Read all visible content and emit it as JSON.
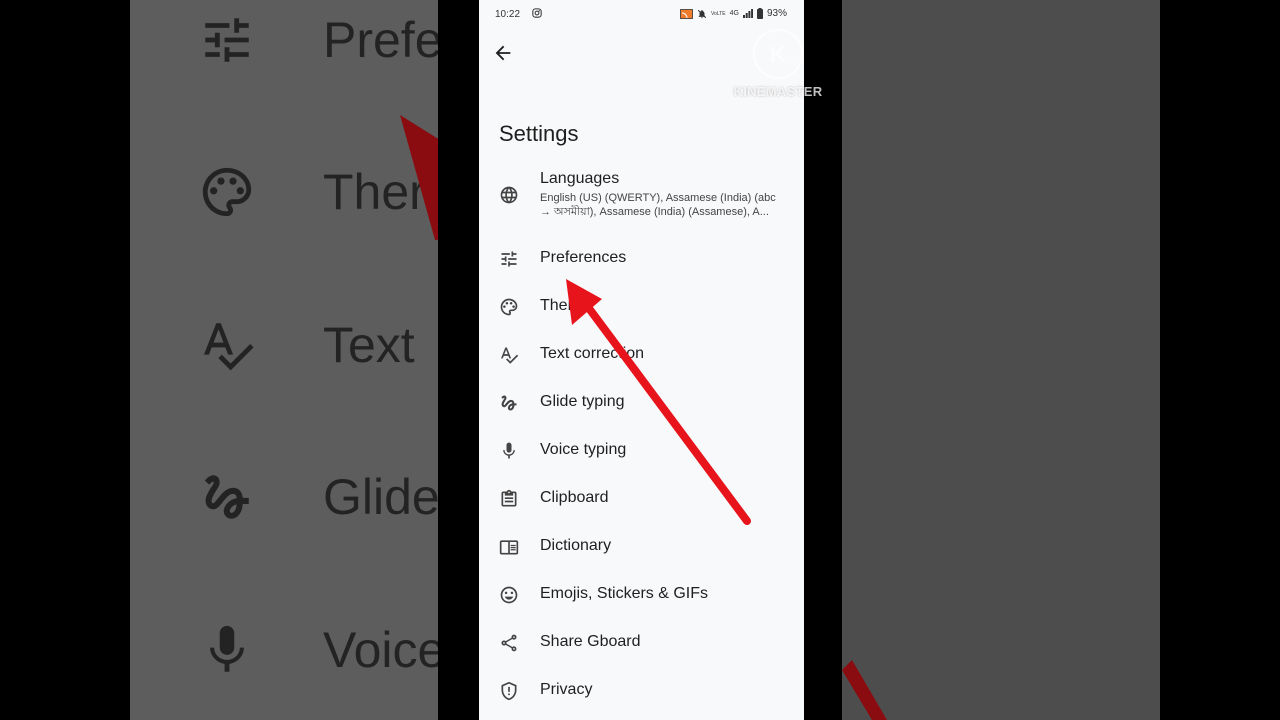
{
  "status_bar": {
    "time": "10:22",
    "battery": "93%",
    "network": "4G",
    "signal_text": "VoLTE"
  },
  "header": {
    "title": "Settings"
  },
  "settings": [
    {
      "label": "Languages",
      "subtitle_line1": "English (US) (QWERTY), Assamese (India) (abc",
      "subtitle_line2": "→ অসমীয়া), Assamese (India) (Assamese), A...",
      "icon": "globe-icon"
    },
    {
      "label": "Preferences",
      "icon": "tune-icon"
    },
    {
      "label": "Theme",
      "icon": "palette-icon"
    },
    {
      "label": "Text correction",
      "icon": "spellcheck-icon"
    },
    {
      "label": "Glide typing",
      "icon": "gesture-icon"
    },
    {
      "label": "Voice typing",
      "icon": "mic-icon"
    },
    {
      "label": "Clipboard",
      "icon": "clipboard-icon"
    },
    {
      "label": "Dictionary",
      "icon": "dictionary-icon"
    },
    {
      "label": "Emojis, Stickers & GIFs",
      "icon": "emoji-icon"
    },
    {
      "label": "Share Gboard",
      "icon": "share-icon"
    },
    {
      "label": "Privacy",
      "icon": "shield-icon"
    }
  ],
  "background_zoom": {
    "left_labels": [
      "Prefe",
      "Ther",
      "Text",
      "Glide",
      "Voice"
    ]
  },
  "watermark": {
    "text": "KINEMASTER"
  },
  "colors": {
    "arrow": "#e8141c",
    "screen_bg": "#f8f9fb",
    "text": "#1f1f1f",
    "side_panel": "#5d5d5d"
  }
}
